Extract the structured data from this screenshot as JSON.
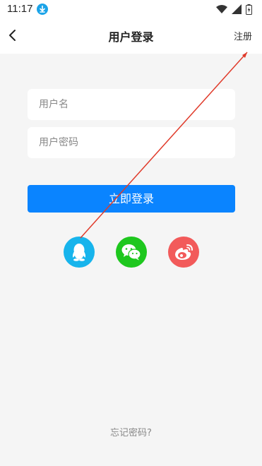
{
  "status_bar": {
    "time": "11:17",
    "icons": [
      "download-icon",
      "wifi-icon",
      "signal-icon",
      "battery-icon"
    ]
  },
  "header": {
    "title": "用户登录",
    "back_icon": "chevron-left-icon",
    "register_label": "注册"
  },
  "form": {
    "username_placeholder": "用户名",
    "password_placeholder": "用户密码",
    "login_label": "立即登录"
  },
  "social": [
    {
      "name": "qq",
      "icon": "qq-icon",
      "color": "#17b4ec"
    },
    {
      "name": "wechat",
      "icon": "wechat-icon",
      "color": "#1ec71e"
    },
    {
      "name": "weibo",
      "icon": "weibo-icon",
      "color": "#f25a5a"
    }
  ],
  "footer": {
    "forgot_label": "忘记密码?"
  },
  "colors": {
    "accent": "#0a84ff",
    "background": "#f5f5f5",
    "annotation_arrow": "#e03a2a"
  }
}
